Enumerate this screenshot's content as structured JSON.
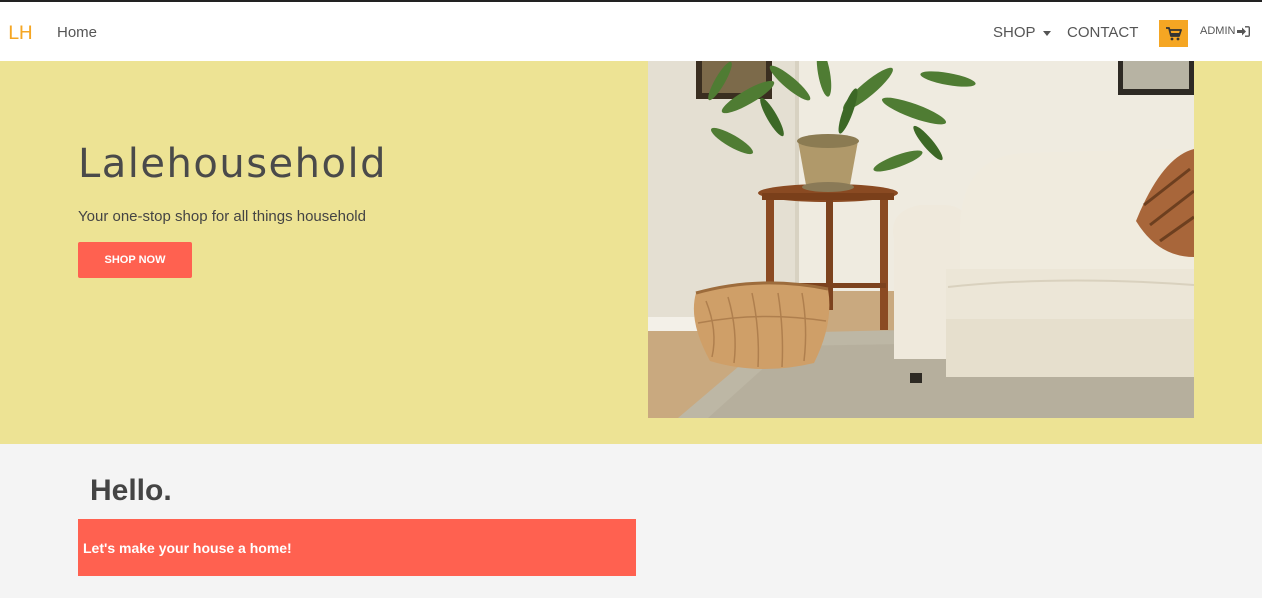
{
  "nav": {
    "brand": "LH",
    "home": "Home",
    "shop": "SHOP",
    "contact": "CONTACT",
    "admin": "ADMIN"
  },
  "hero": {
    "title": "Lalehousehold",
    "subtitle": "Your one-stop shop for all things household",
    "cta": "SHOP NOW"
  },
  "welcome": {
    "heading": "Hello.",
    "banner": "Let's make your house a home!"
  },
  "colors": {
    "accent": "#f5a623",
    "hero_bg": "#ede394",
    "cta": "#ff6150",
    "page_bg": "#f4f4f4"
  },
  "icons": {
    "cart": "cart-icon",
    "admin": "sign-in-icon",
    "shop_menu": "caret-down-icon"
  }
}
